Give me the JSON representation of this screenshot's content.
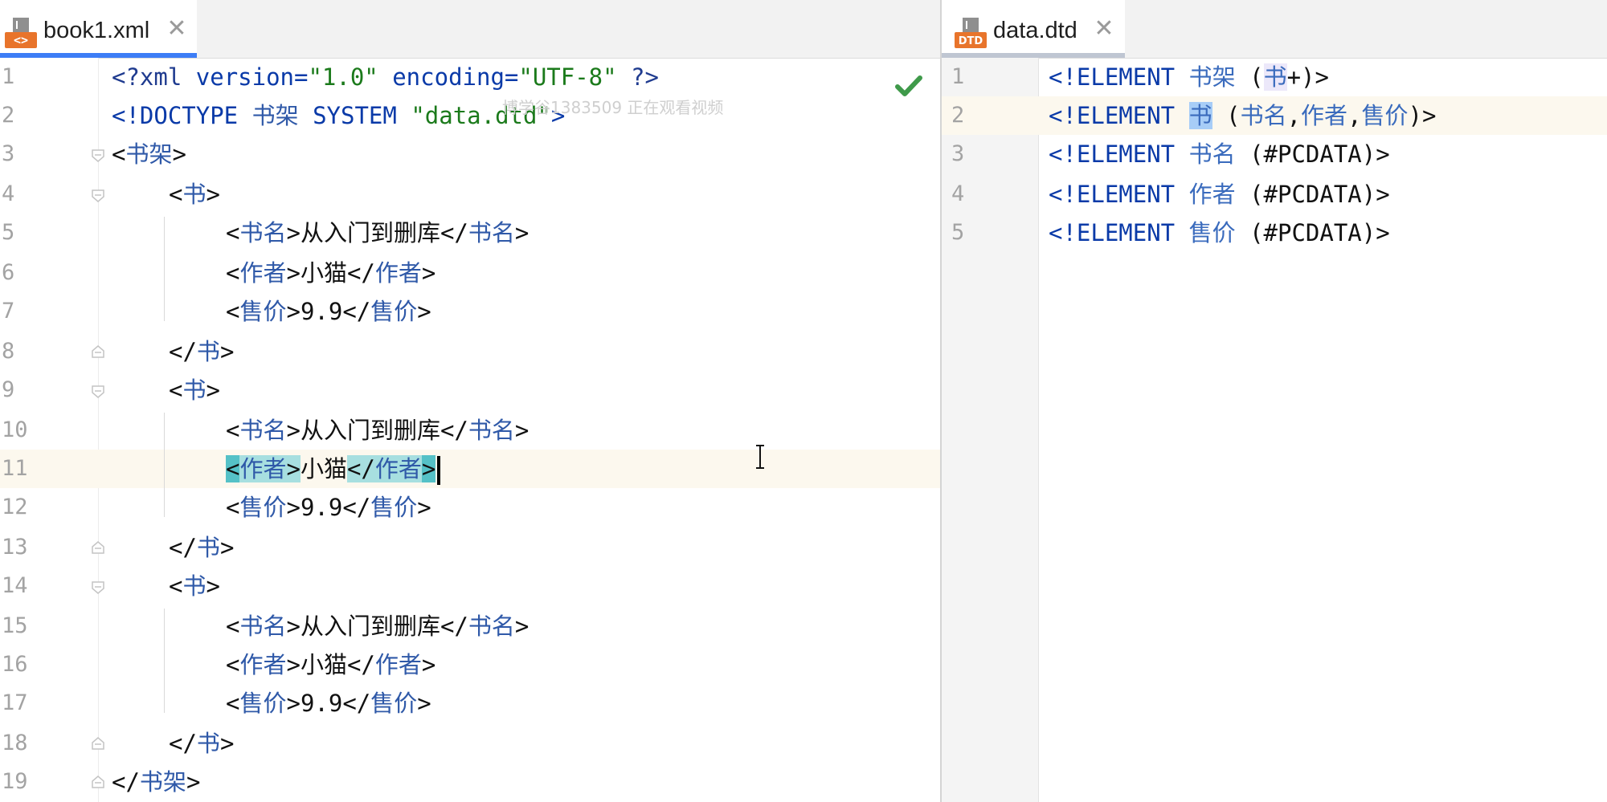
{
  "tabs": {
    "left": {
      "title": "book1.xml",
      "close": "✕",
      "icon": "xml-file-icon",
      "icon_text": "<>"
    },
    "right": {
      "title": "data.dtd",
      "close": "✕",
      "icon": "dtd-file-icon",
      "icon_text": "DTD"
    }
  },
  "left_editor": {
    "line_numbers": [
      "1",
      "2",
      "3",
      "4",
      "5",
      "6",
      "7",
      "8",
      "9",
      "10",
      "11",
      "12",
      "13",
      "14",
      "15",
      "16",
      "17",
      "18",
      "19"
    ],
    "lines": {
      "l1": {
        "open": "<?",
        "name": "xml",
        "attr1": " version=",
        "val1": "\"1.0\"",
        "attr2": " encoding=",
        "val2": "\"UTF-8\"",
        "close": " ?>"
      },
      "l2": {
        "decl": "<!DOCTYPE ",
        "root": "书架",
        "system": " SYSTEM ",
        "file": "\"data.dtd\"",
        "end": ">"
      },
      "l3": {
        "lt": "<",
        "name": "书架",
        "gt": ">"
      },
      "l4": {
        "lt": "<",
        "name": "书",
        "gt": ">"
      },
      "l5": {
        "lt": "<",
        "name": "书名",
        "gt": ">",
        "text": "从入门到删库",
        "lt2": "</",
        "name2": "书名",
        "gt2": ">"
      },
      "l6": {
        "lt": "<",
        "name": "作者",
        "gt": ">",
        "text": "小猫",
        "lt2": "</",
        "name2": "作者",
        "gt2": ">"
      },
      "l7": {
        "lt": "<",
        "name": "售价",
        "gt": ">",
        "text": "9.9",
        "lt2": "</",
        "name2": "售价",
        "gt2": ">"
      },
      "l8": {
        "lt": "</",
        "name": "书",
        "gt": ">"
      },
      "l9": {
        "lt": "<",
        "name": "书",
        "gt": ">"
      },
      "l10": {
        "lt": "<",
        "name": "书名",
        "gt": ">",
        "text": "从入门到删库",
        "lt2": "</",
        "name2": "书名",
        "gt2": ">"
      },
      "l11": {
        "lt": "<",
        "name": "作者",
        "gt": ">",
        "text": "小猫",
        "lt2": "</",
        "name2": "作者",
        "gt2": ">"
      },
      "l12": {
        "lt": "<",
        "name": "售价",
        "gt": ">",
        "text": "9.9",
        "lt2": "</",
        "name2": "售价",
        "gt2": ">"
      },
      "l13": {
        "lt": "</",
        "name": "书",
        "gt": ">"
      },
      "l14": {
        "lt": "<",
        "name": "书",
        "gt": ">"
      },
      "l15": {
        "lt": "<",
        "name": "书名",
        "gt": ">",
        "text": "从入门到删库",
        "lt2": "</",
        "name2": "书名",
        "gt2": ">"
      },
      "l16": {
        "lt": "<",
        "name": "作者",
        "gt": ">",
        "text": "小猫",
        "lt2": "</",
        "name2": "作者",
        "gt2": ">"
      },
      "l17": {
        "lt": "<",
        "name": "售价",
        "gt": ">",
        "text": "9.9",
        "lt2": "</",
        "name2": "售价",
        "gt2": ">"
      },
      "l18": {
        "lt": "</",
        "name": "书",
        "gt": ">"
      },
      "l19": {
        "lt": "</",
        "name": "书架",
        "gt": ">"
      }
    },
    "watermark": "博学谷1383509 正在观看视频",
    "status_icon": "check-icon"
  },
  "right_editor": {
    "line_numbers": [
      "1",
      "2",
      "3",
      "4",
      "5"
    ],
    "lines": {
      "d1": {
        "kw": "<!ELEMENT ",
        "name": "书架",
        "sp": " ",
        "open": "(",
        "child": "书",
        "rest": "+)>"
      },
      "d2": {
        "kw": "<!ELEMENT ",
        "name": "书",
        "sp": " ",
        "open": "(",
        "c1": "书名",
        "comma1": ",",
        "c2": "作者",
        "comma2": ",",
        "c3": "售价",
        "rest": ")>"
      },
      "d3": {
        "kw": "<!ELEMENT ",
        "name": "书名",
        "rest": " (#PCDATA)>"
      },
      "d4": {
        "kw": "<!ELEMENT ",
        "name": "作者",
        "rest": " (#PCDATA)>"
      },
      "d5": {
        "kw": "<!ELEMENT ",
        "name": "售价",
        "rest": " (#PCDATA)>"
      }
    }
  },
  "colors": {
    "accent": "#3d7df6",
    "xml_tag": "#1f3b8f",
    "string": "#1b7a1b",
    "check": "#3f9a4a",
    "current_line": "#fcf8ee"
  }
}
